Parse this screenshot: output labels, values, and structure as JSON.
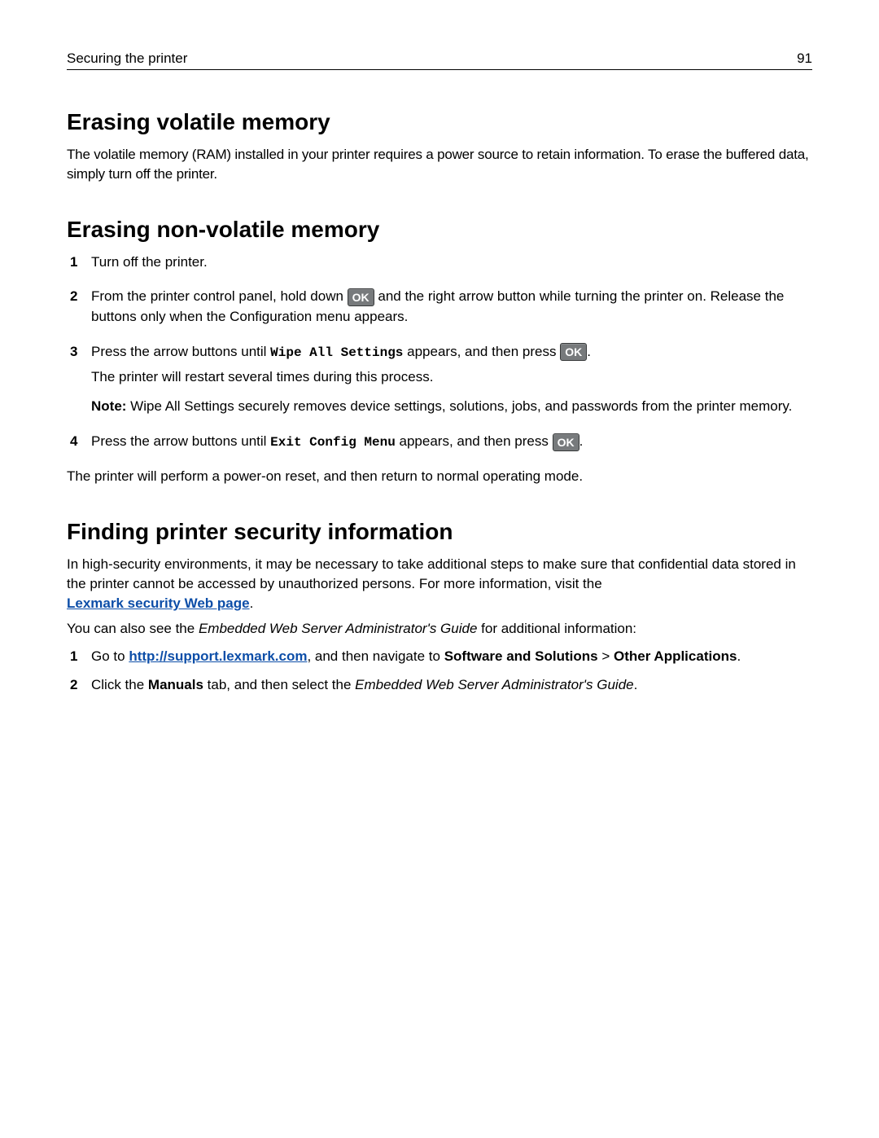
{
  "header": {
    "section": "Securing the printer",
    "page": "91"
  },
  "s1": {
    "title": "Erasing volatile memory",
    "body": "The volatile memory (RAM) installed in your printer requires a power source to retain information. To erase the buffered data, simply turn off the printer."
  },
  "s2": {
    "title": "Erasing non-volatile memory",
    "step1": "Turn off the printer.",
    "step2_a": "From the printer control panel, hold down ",
    "step2_b": " and the right arrow button while turning the printer on. Release the buttons only when the Configuration menu appears.",
    "step3_a": "Press the arrow buttons until ",
    "step3_code": "Wipe All Settings",
    "step3_b": " appears, and then press ",
    "step3_after": "The printer will restart several times during this process.",
    "step3_note_label": "Note:",
    "step3_note": " Wipe All Settings securely removes device settings, solutions, jobs, and passwords from the printer memory.",
    "step4_a": "Press the arrow buttons until ",
    "step4_code": "Exit Config Menu",
    "step4_b": " appears, and then press ",
    "after": "The printer will perform a power-on reset, and then return to normal operating mode."
  },
  "s3": {
    "title": "Finding printer security information",
    "body_a": "In high-security environments, it may be necessary to take additional steps to make sure that confidential data stored in the printer cannot be accessed by unauthorized persons. For more information, visit the ",
    "link1": "Lexmark security Web page",
    "period1": ".",
    "body_b_a": "You can also see the ",
    "body_b_em": "Embedded Web Server Administrator's Guide",
    "body_b_b": " for additional information:",
    "sub1_a": "Go to ",
    "sub1_link": "http://support.lexmark.com",
    "sub1_b": ", and then navigate to ",
    "sub1_bold1": "Software and Solutions",
    "sub1_gt": " > ",
    "sub1_bold2": "Other Applications",
    "sub1_end": ".",
    "sub2_a": "Click the ",
    "sub2_bold": "Manuals",
    "sub2_b": " tab, and then select the ",
    "sub2_em": "Embedded Web Server Administrator's Guide",
    "sub2_end": "."
  },
  "ok_label": "OK"
}
